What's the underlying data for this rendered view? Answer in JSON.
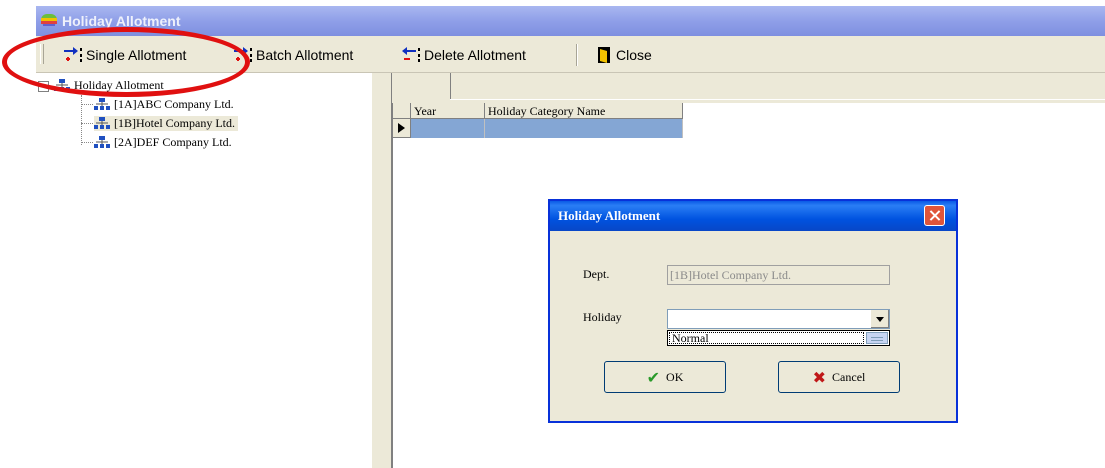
{
  "window": {
    "title": "Holiday Allotment"
  },
  "toolbar": {
    "single_label": "Single Allotment",
    "batch_label": "Batch Allotment",
    "delete_label": "Delete Allotment",
    "close_label": "Close"
  },
  "tree": {
    "root": "Holiday Allotment",
    "items": [
      {
        "label": "[1A]ABC Company Ltd."
      },
      {
        "label": "[1B]Hotel Company Ltd."
      },
      {
        "label": "[2A]DEF Company Ltd."
      }
    ]
  },
  "grid": {
    "columns": [
      "Year",
      "Holiday Category Name"
    ]
  },
  "dialog": {
    "title": "Holiday Allotment",
    "dept_label": "Dept.",
    "dept_value": "[1B]Hotel Company Ltd.",
    "holiday_label": "Holiday",
    "holiday_value": "",
    "holiday_options": [
      "Normal"
    ],
    "ok_label": "OK",
    "cancel_label": "Cancel"
  },
  "colors": {
    "annotation": "#e01010",
    "row_selection": "#84a6d4"
  }
}
